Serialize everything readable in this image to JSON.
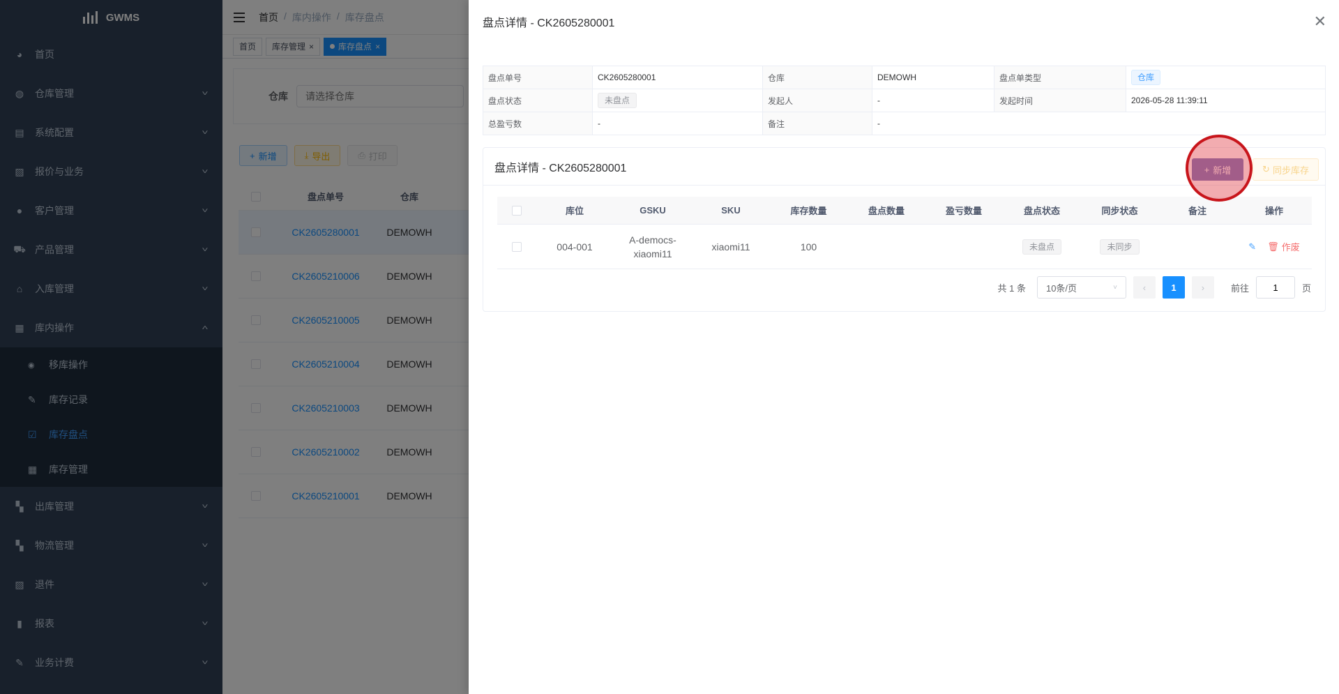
{
  "app": {
    "logo": "GWMS"
  },
  "sidebar": {
    "items": [
      {
        "label": "首页",
        "icon": "dashboard-icon"
      },
      {
        "label": "仓库管理",
        "icon": "globe-icon"
      },
      {
        "label": "系统配置",
        "icon": "document-icon"
      },
      {
        "label": "报价与业务",
        "icon": "form-icon"
      },
      {
        "label": "客户管理",
        "icon": "user-icon"
      },
      {
        "label": "产品管理",
        "icon": "cart-icon"
      },
      {
        "label": "入库管理",
        "icon": "home-icon"
      },
      {
        "label": "库内操作",
        "icon": "table-icon"
      }
    ],
    "subitems": [
      {
        "label": "移库操作",
        "icon": "eye-icon"
      },
      {
        "label": "库存记录",
        "icon": "edit-icon"
      },
      {
        "label": "库存盘点",
        "icon": "checkbox-icon"
      },
      {
        "label": "库存管理",
        "icon": "table-icon"
      }
    ],
    "items_after": [
      {
        "label": "出库管理",
        "icon": "grid-icon"
      },
      {
        "label": "物流管理",
        "icon": "grid-icon"
      },
      {
        "label": "退件",
        "icon": "form-icon"
      },
      {
        "label": "报表",
        "icon": "chart-icon"
      },
      {
        "label": "业务计费",
        "icon": "edit-icon"
      }
    ]
  },
  "navbar": {
    "breadcrumb": [
      "首页",
      "库内操作",
      "库存盘点"
    ]
  },
  "tags": [
    "首页",
    "库存管理",
    "库存盘点"
  ],
  "filter": {
    "label": "仓库",
    "placeholder": "请选择仓库"
  },
  "buttons": {
    "add": "新增",
    "export": "导出",
    "print": "打印"
  },
  "list": {
    "headers": [
      "盘点单号",
      "仓库"
    ],
    "rows": [
      {
        "no": "CK2605280001",
        "wh": "DEMOWH"
      },
      {
        "no": "CK2605210006",
        "wh": "DEMOWH"
      },
      {
        "no": "CK2605210005",
        "wh": "DEMOWH"
      },
      {
        "no": "CK2605210004",
        "wh": "DEMOWH"
      },
      {
        "no": "CK2605210003",
        "wh": "DEMOWH"
      },
      {
        "no": "CK2605210002",
        "wh": "DEMOWH"
      },
      {
        "no": "CK2605210001",
        "wh": "DEMOWH"
      }
    ]
  },
  "drawer": {
    "title": "盘点详情 - CK2605280001",
    "desc": {
      "no_label": "盘点单号",
      "no": "CK2605280001",
      "wh_label": "仓库",
      "wh": "DEMOWH",
      "type_label": "盘点单类型",
      "type": "仓库",
      "status_label": "盘点状态",
      "status": "未盘点",
      "initiator_label": "发起人",
      "initiator": "-",
      "time_label": "发起时间",
      "time": "2026-05-28 11:39:11",
      "diff_label": "总盈亏数",
      "diff": "-",
      "remark_label": "备注",
      "remark": "-"
    },
    "card_title": "盘点详情 - CK2605280001",
    "add_label": "新增",
    "sync_label": "同步库存",
    "table": {
      "headers": [
        "库位",
        "GSKU",
        "SKU",
        "库存数量",
        "盘点数量",
        "盈亏数量",
        "盘点状态",
        "同步状态",
        "备注",
        "操作"
      ],
      "rows": [
        {
          "loc": "004-001",
          "gsku": "A-democs-xiaomi11",
          "sku": "xiaomi11",
          "qty": "100",
          "count": "",
          "diff": "",
          "status": "未盘点",
          "sync": "未同步",
          "remark": "",
          "void": "作废"
        }
      ]
    },
    "pager": {
      "total": "共 1 条",
      "size": "10条/页",
      "page": "1",
      "goto": "前往",
      "goto_value": "1",
      "unit": "页"
    }
  }
}
